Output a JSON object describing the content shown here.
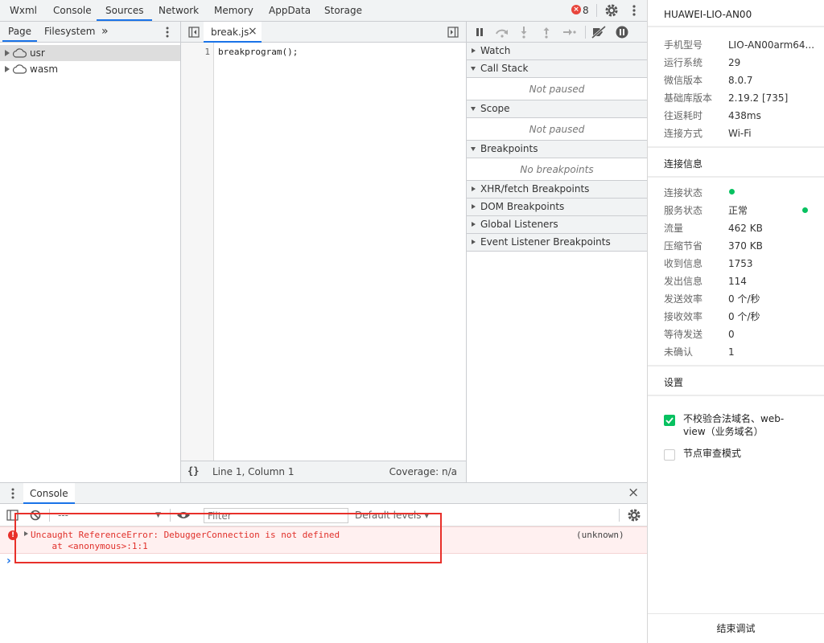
{
  "top_tabs": [
    {
      "label": "Wxml"
    },
    {
      "label": "Console"
    },
    {
      "label": "Sources"
    },
    {
      "label": "Network"
    },
    {
      "label": "Memory"
    },
    {
      "label": "AppData"
    },
    {
      "label": "Storage"
    }
  ],
  "error_count": "8",
  "navigator": {
    "tabs": [
      {
        "label": "Page"
      },
      {
        "label": "Filesystem"
      }
    ],
    "more": "»",
    "tree": [
      {
        "label": "usr"
      },
      {
        "label": "wasm"
      }
    ]
  },
  "editor": {
    "tab_label": "break.js",
    "close_glyph": "×",
    "line_number": "1",
    "code": "breakprogram();",
    "status_braces": "{}",
    "status_position": "Line 1, Column 1",
    "status_coverage": "Coverage: n/a"
  },
  "debugger": {
    "sections": {
      "watch": "Watch",
      "call_stack": "Call Stack",
      "call_stack_empty": "Not paused",
      "scope": "Scope",
      "scope_empty": "Not paused",
      "breakpoints": "Breakpoints",
      "breakpoints_empty": "No breakpoints",
      "xhr": "XHR/fetch Breakpoints",
      "dom": "DOM Breakpoints",
      "global": "Global Listeners",
      "event": "Event Listener Breakpoints"
    }
  },
  "console": {
    "tab_label": "Console",
    "close_glyph": "×",
    "context": "---",
    "filter_placeholder": "Filter",
    "levels": "Default levels ▾",
    "error_line1": "Uncaught ReferenceError: DebuggerConnection is not defined",
    "error_line2": "    at <anonymous>:1:1",
    "error_source": "(unknown)",
    "prompt": "›"
  },
  "device_panel": {
    "device_name": "HUAWEI-LIO-AN00",
    "info": [
      {
        "label": "手机型号",
        "value": "LIO-AN00arm64..."
      },
      {
        "label": "运行系统",
        "value": "29"
      },
      {
        "label": "微信版本",
        "value": "8.0.7"
      },
      {
        "label": "基础库版本",
        "value": "2.19.2 [735]"
      },
      {
        "label": "往返耗时",
        "value": "438ms"
      },
      {
        "label": "连接方式",
        "value": "Wi-Fi"
      }
    ],
    "connection_title": "连接信息",
    "connection": [
      {
        "label": "连接状态",
        "value": ""
      },
      {
        "label": "服务状态",
        "value": "正常"
      },
      {
        "label": "流量",
        "value": "462 KB"
      },
      {
        "label": "压缩节省",
        "value": "370 KB"
      },
      {
        "label": "收到信息",
        "value": "1753"
      },
      {
        "label": "发出信息",
        "value": "114"
      },
      {
        "label": "发送效率",
        "value": "0 个/秒"
      },
      {
        "label": "接收效率",
        "value": "0 个/秒"
      },
      {
        "label": "等待发送",
        "value": "0"
      },
      {
        "label": "未确认",
        "value": "1"
      }
    ],
    "status_color": "#07c160",
    "settings_title": "设置",
    "settings": [
      {
        "label": "不校验合法域名、web-view（业务域名）",
        "checked": true
      },
      {
        "label": "节点审查模式",
        "checked": false
      }
    ],
    "end_debug": "结束调试"
  },
  "colors": {
    "accent": "#1a73e8",
    "error_red": "#e8302a",
    "success_green": "#07c160"
  }
}
